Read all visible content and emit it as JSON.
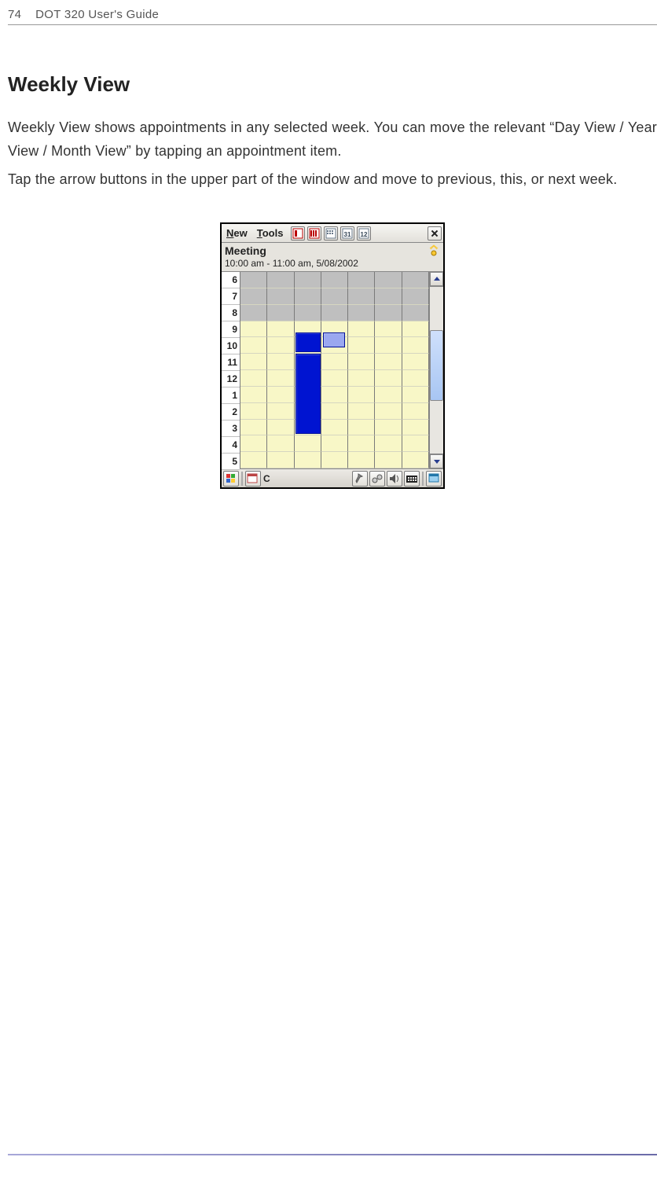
{
  "page": {
    "number": "74",
    "doc_title": "DOT 320 User's Guide"
  },
  "heading": "Weekly View",
  "para1": "Weekly View shows appointments in any selected week. You can move the relevant “Day View / Year View / Month View” by tapping an appointment item.",
  "para2": "Tap the arrow buttons in the upper part of the window and move to previous, this, or next week.",
  "calendar": {
    "menus": {
      "new": "New",
      "tools": "Tools"
    },
    "event_title": "Meeting",
    "event_time": "10:00 am - 11:00 am,  5/08/2002",
    "hours": [
      "6",
      "7",
      "8",
      "9",
      "10",
      "11",
      "12",
      "1",
      "2",
      "3",
      "4",
      "5"
    ],
    "taskbar_label": "C"
  }
}
